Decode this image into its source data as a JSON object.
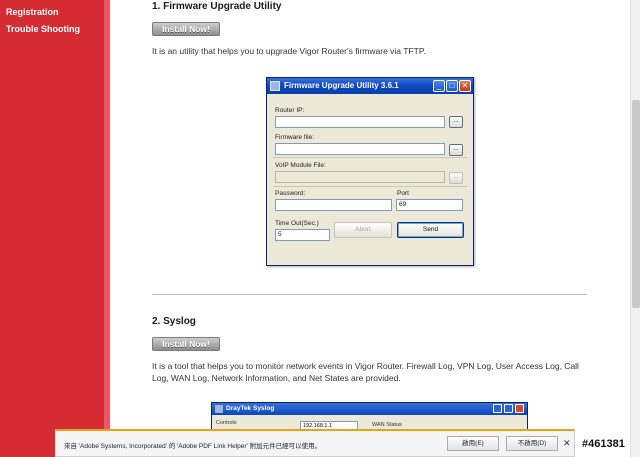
{
  "sidebar": {
    "items": [
      {
        "label": "Registration"
      },
      {
        "label": "Trouble Shooting"
      }
    ]
  },
  "section1": {
    "heading": "1. Firmware Upgrade Utility",
    "install_label": "Install Now!",
    "description": "It is an utility that helps you to upgrade Vigor Router's firmware via TFTP."
  },
  "dialog": {
    "title": "Firmware Upgrade Utility 3.6.1",
    "router_ip_label": "Router IP:",
    "router_ip_value": "",
    "firmware_file_label": "Firmware file:",
    "firmware_file_value": "",
    "voip_label": "VoIP Module File:",
    "voip_value": "",
    "browse_label": "...",
    "password_label": "Password:",
    "password_value": "",
    "port_label": "Port",
    "port_value": "69",
    "timeout_label": "Time Out(Sec.)",
    "timeout_value": "5",
    "abort_label": "Abort",
    "send_label": "Send",
    "minimize_glyph": "_",
    "maximize_glyph": "□",
    "close_glyph": "✕"
  },
  "section2": {
    "heading": "2. Syslog",
    "install_label": "Install Now!",
    "description": "It is a tool that helps you to monitor network events in Vigor Router. Firewall Log, VPN Log, User Access Log, Call Log, WAN Log, Network Information, and Net States are provided."
  },
  "dialog2": {
    "title": "DrayTek Syslog",
    "tab_label": "Controls",
    "ip_value": "192.168.1.1",
    "wan_status_label": "WAN Status"
  },
  "infobar": {
    "message": "來自 'Adobe Systems, Incorporated' 的 'Adobe PDF Link Helper' 附加元件已經可以使用。",
    "enable_label": "啟用(E)",
    "disable_label": "不啟用(D)",
    "close_glyph": "✕"
  },
  "watermark": "#461381"
}
